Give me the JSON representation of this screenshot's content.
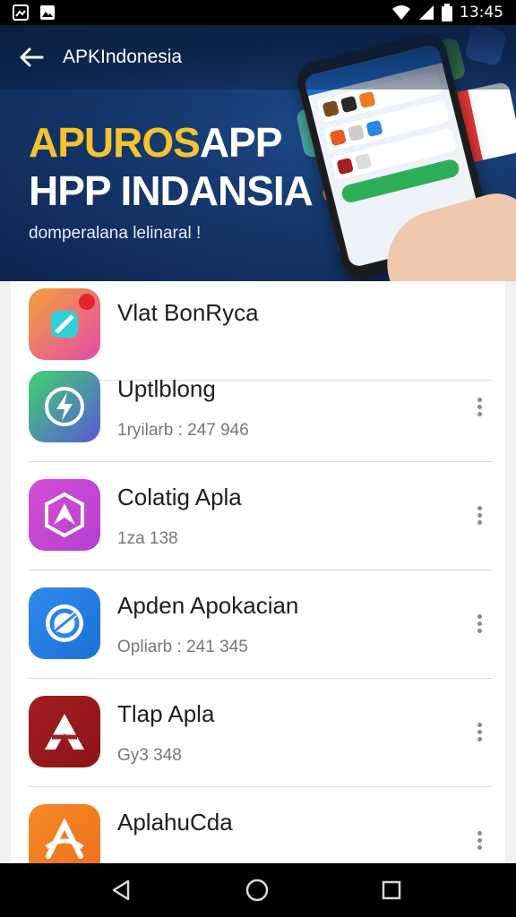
{
  "status_bar": {
    "time": "13:45",
    "left_icons": [
      "image-icon",
      "photo-icon"
    ],
    "right_icons": [
      "wifi-icon",
      "signal-icon",
      "battery-icon"
    ]
  },
  "app_bar": {
    "title": "APKIndonesia",
    "back_icon": "back-arrow-icon"
  },
  "banner": {
    "headline_yellow": "APUROS",
    "headline_white": "APP",
    "headline_line2": "HPP INDANSIA",
    "subtitle": "domperalana lelinaral !"
  },
  "apps": [
    {
      "name": "Vlat BonRyca",
      "meta": "",
      "icon": "app-icon-pink-orange",
      "colors": [
        "#f4a23a",
        "#e24ba8"
      ]
    },
    {
      "name": "Uptlblong",
      "meta": "1ryilarb : 247 946",
      "icon": "lightning-icon",
      "colors": [
        "#3fd36b",
        "#5a59d8"
      ]
    },
    {
      "name": "Colatig Apla",
      "meta": "1za 138",
      "icon": "hexagon-arrow-icon",
      "colors": [
        "#d24fd3",
        "#b63fd0"
      ]
    },
    {
      "name": "Apden Apokacian",
      "meta": "Opliarb : 241 345",
      "icon": "check-circle-icon",
      "colors": [
        "#2f8bee",
        "#1c6fd6"
      ]
    },
    {
      "name": "Tlap Apla",
      "meta": "Gy3 348",
      "icon": "arrow-a-icon",
      "colors": [
        "#a21d22",
        "#8d1519"
      ]
    },
    {
      "name": "AplahuCda",
      "meta": "",
      "icon": "swirl-a-icon",
      "colors": [
        "#f58a27",
        "#ee6f1b"
      ]
    }
  ],
  "nav": {
    "back_icon": "nav-back-icon",
    "home_icon": "nav-home-icon",
    "recents_icon": "nav-recents-icon"
  }
}
